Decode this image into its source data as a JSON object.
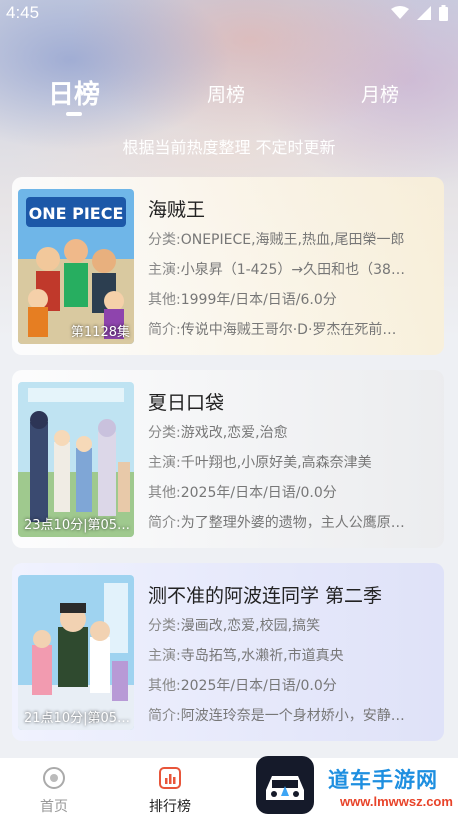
{
  "status_bar": {
    "time": "4:45"
  },
  "tabs": [
    {
      "label": "日榜",
      "active": true
    },
    {
      "label": "周榜",
      "active": false
    },
    {
      "label": "月榜",
      "active": false
    }
  ],
  "subtitle": "根据当前热度整理 不定时更新",
  "items": [
    {
      "title": "海贼王",
      "cover_caption": "第1128集",
      "category_key": "分类:",
      "category": "ONEPIECE,海贼王,热血,尾田榮一郎",
      "cast_key": "主演:",
      "cast": "小泉昇（1-425）→久田和也（38…",
      "other_key": "其他:",
      "other": "1999年/日本/日语/6.0分",
      "intro_key": "简介:",
      "intro": "传说中海贼王哥尔·D·罗杰在死前…"
    },
    {
      "title": "夏日口袋",
      "cover_caption": "23点10分|第05…",
      "category_key": "分类:",
      "category": "游戏改,恋爱,治愈",
      "cast_key": "主演:",
      "cast": "千叶翔也,小原好美,高森奈津美",
      "other_key": "其他:",
      "other": "2025年/日本/日语/0.0分",
      "intro_key": "简介:",
      "intro": "为了整理外婆的遗物，主人公鹰原…"
    },
    {
      "title": "测不准的阿波连同学 第二季",
      "cover_caption": "21点10分|第05…",
      "category_key": "分类:",
      "category": "漫画改,恋爱,校园,搞笑",
      "cast_key": "主演:",
      "cast": "寺岛拓笃,水濑祈,市道真央",
      "other_key": "其他:",
      "other": "2025年/日本/日语/0.0分",
      "intro_key": "简介:",
      "intro": "阿波连玲奈是一个身材娇小，安静…"
    }
  ],
  "bottom_nav": {
    "home_label": "首页",
    "rank_label": "排行榜"
  },
  "watermark": {
    "text": "道车手游网",
    "url": "www.lmwwsz.com"
  },
  "colors": {
    "active_text": "#222222",
    "inactive_text": "#999999",
    "watermark_blue": "#1e8fe0",
    "watermark_red": "#e8442a"
  }
}
